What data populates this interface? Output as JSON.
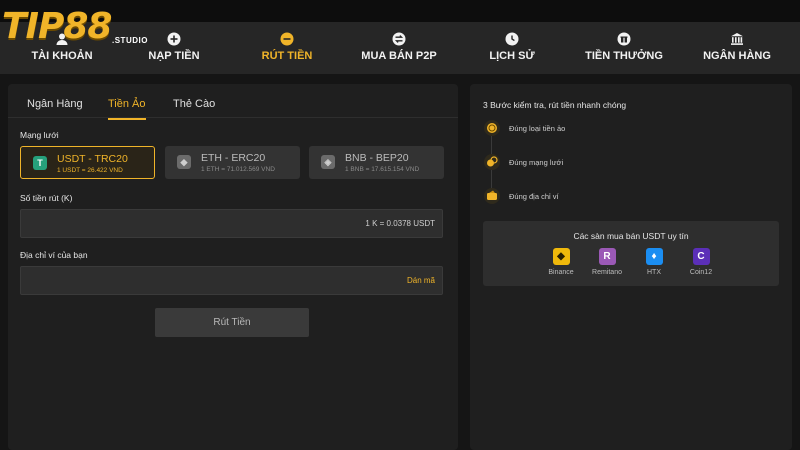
{
  "brand": {
    "name": "TIP88",
    "suffix": ".STUDIO"
  },
  "nav": [
    {
      "label": "TÀI KHOẢN",
      "icon": "user-icon"
    },
    {
      "label": "NẠP TIỀN",
      "icon": "plus-circle-icon"
    },
    {
      "label": "RÚT TIỀN",
      "icon": "minus-circle-icon",
      "active": true
    },
    {
      "label": "MUA BÁN P2P",
      "icon": "swap-icon"
    },
    {
      "label": "LỊCH SỬ",
      "icon": "clock-icon"
    },
    {
      "label": "TIỀN THƯỞNG",
      "icon": "gift-icon"
    },
    {
      "label": "NGÂN HÀNG",
      "icon": "bank-icon"
    }
  ],
  "tabs": [
    {
      "label": "Ngân Hàng"
    },
    {
      "label": "Tiền Ảo",
      "active": true
    },
    {
      "label": "Thẻ Cào"
    }
  ],
  "form": {
    "network_label": "Mạng lưới",
    "networks": [
      {
        "title": "USDT - TRC20",
        "rate": "1 USDT = 26.422 VND",
        "icon": "tether-icon",
        "selected": true
      },
      {
        "title": "ETH - ERC20",
        "rate": "1 ETH = 71.012.569 VND",
        "icon": "ethereum-icon"
      },
      {
        "title": "BNB - BEP20",
        "rate": "1 BNB = 17.615.154 VND",
        "icon": "bnb-icon"
      }
    ],
    "amount_label": "Số tiền rút (K)",
    "amount_hint": "1 K = 0.0378 USDT",
    "address_label": "Địa chỉ ví của bạn",
    "paste_label": "Dán mã",
    "submit_label": "Rút Tiền"
  },
  "guide": {
    "title": "3 Bước kiểm tra, rút tiền nhanh chóng",
    "steps": [
      {
        "text": "Đúng loại tiền ảo",
        "icon": "coin-icon"
      },
      {
        "text": "Đúng mạng lưới",
        "icon": "network-icon"
      },
      {
        "text": "Đúng địa chỉ ví",
        "icon": "wallet-icon"
      }
    ],
    "exchanges_title": "Các sàn mua bán USDT uy tín",
    "exchanges": [
      {
        "name": "Binance",
        "color": "#f0b90b",
        "icon": "binance-icon"
      },
      {
        "name": "Remitano",
        "color": "#9b59b6",
        "icon": "remitano-icon"
      },
      {
        "name": "HTX",
        "color": "#1b8ef2",
        "icon": "htx-icon"
      },
      {
        "name": "Coin12",
        "color": "#5b2fb8",
        "icon": "coin12-icon"
      }
    ]
  },
  "colors": {
    "accent": "#f0b429",
    "background": "#151515",
    "panel": "#1f1f1f",
    "nav": "#262626"
  }
}
